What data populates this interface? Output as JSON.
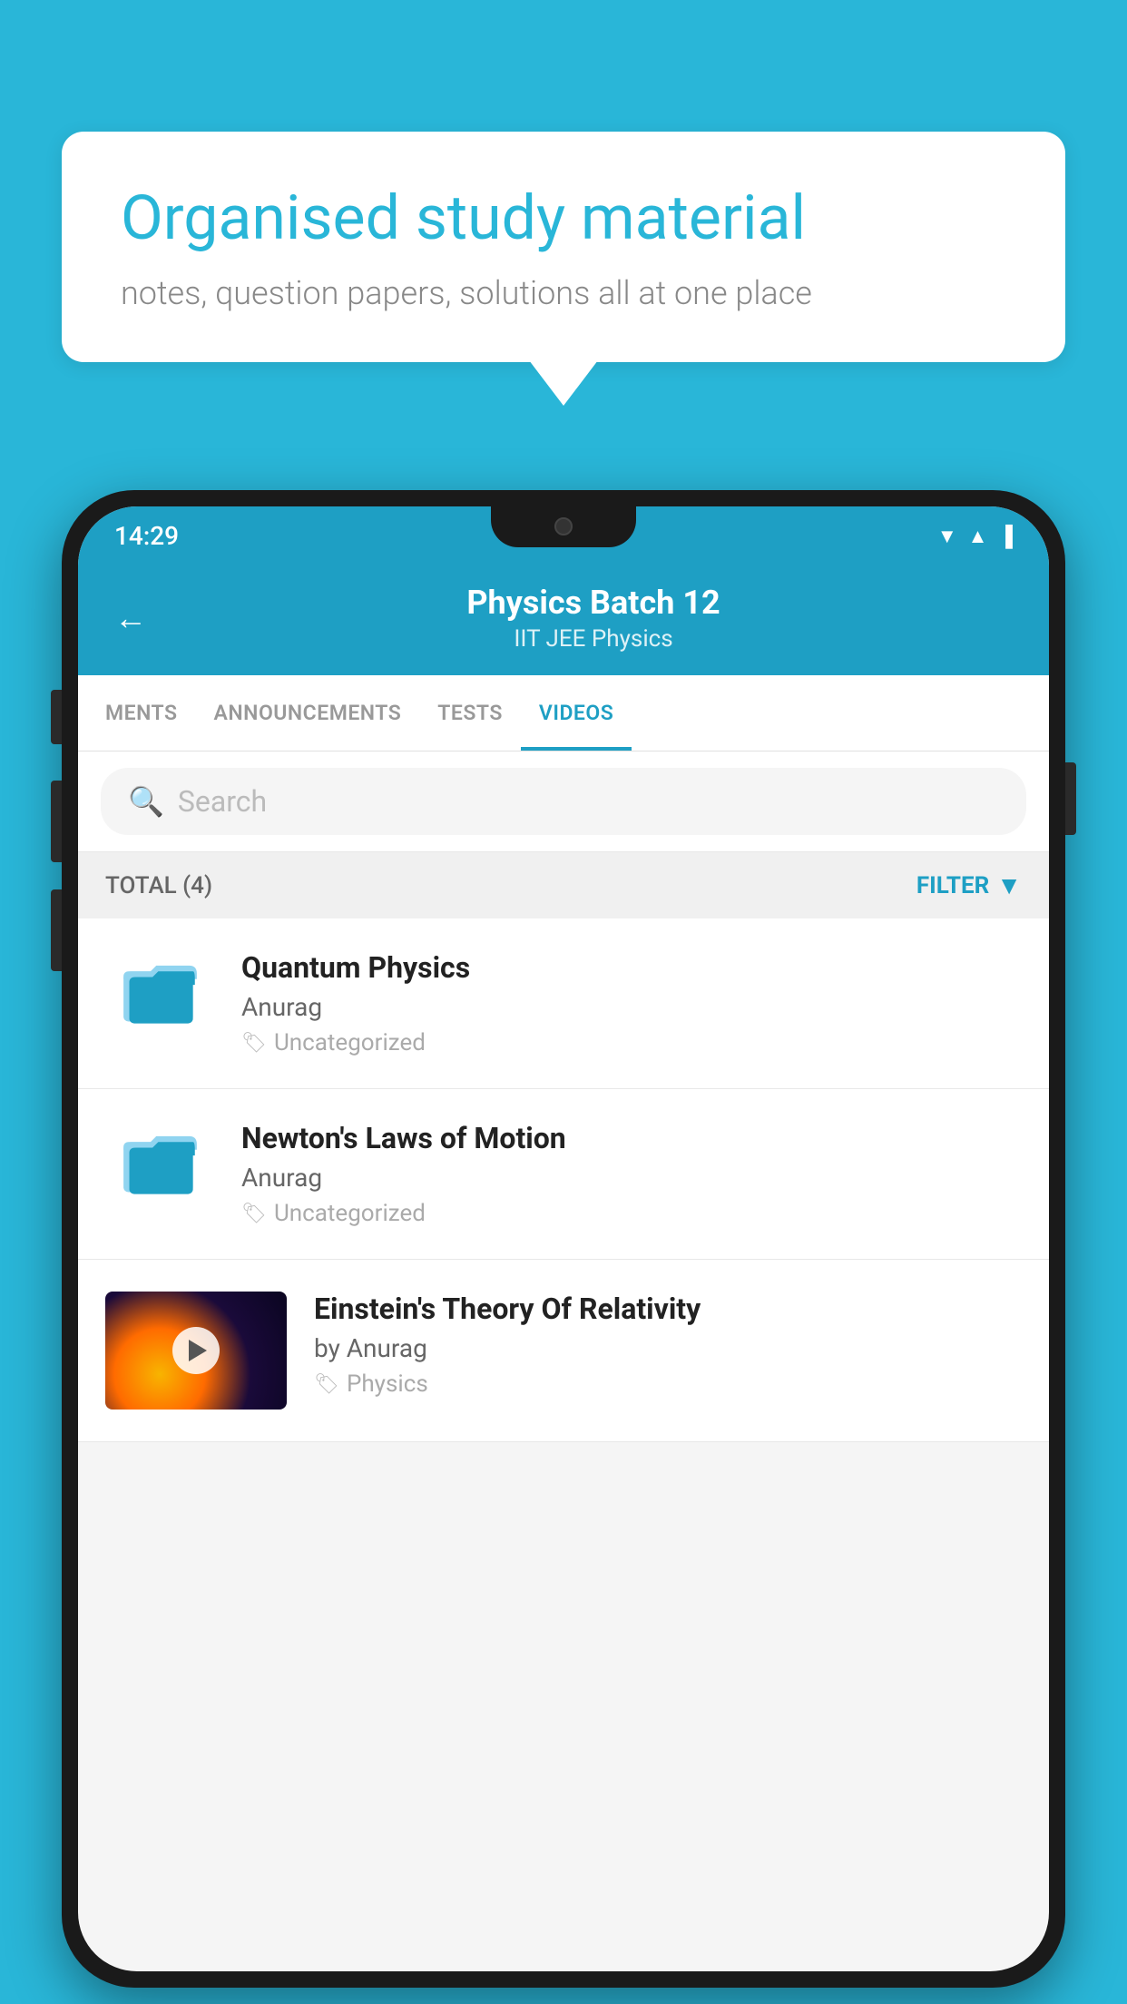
{
  "background_color": "#29b6d8",
  "speech_bubble": {
    "title": "Organised study material",
    "subtitle": "notes, question papers, solutions all at one place"
  },
  "phone": {
    "status_bar": {
      "time": "14:29",
      "icons": [
        "wifi",
        "signal",
        "battery"
      ]
    },
    "header": {
      "back_label": "←",
      "title": "Physics Batch 12",
      "subtitle": "IIT JEE   Physics"
    },
    "tabs": [
      {
        "label": "MENTS",
        "active": false
      },
      {
        "label": "ANNOUNCEMENTS",
        "active": false
      },
      {
        "label": "TESTS",
        "active": false
      },
      {
        "label": "VIDEOS",
        "active": true
      }
    ],
    "search": {
      "placeholder": "Search"
    },
    "filter_bar": {
      "total_label": "TOTAL (4)",
      "filter_label": "FILTER"
    },
    "videos": [
      {
        "id": 1,
        "title": "Quantum Physics",
        "author": "Anurag",
        "tag": "Uncategorized",
        "type": "folder"
      },
      {
        "id": 2,
        "title": "Newton's Laws of Motion",
        "author": "Anurag",
        "tag": "Uncategorized",
        "type": "folder"
      },
      {
        "id": 3,
        "title": "Einstein's Theory Of Relativity",
        "author": "by Anurag",
        "tag": "Physics",
        "type": "video"
      }
    ]
  }
}
